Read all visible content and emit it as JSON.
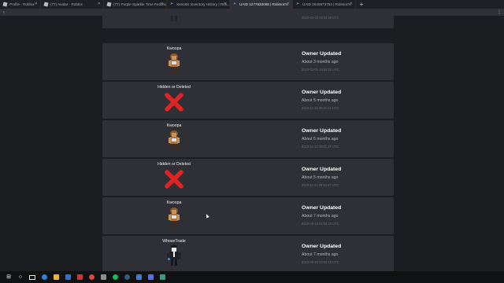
{
  "browser": {
    "tabs": [
      {
        "label": "Profile - Roblox",
        "favicon": "roblox-icon",
        "active": false
      },
      {
        "label": "(77) Avatar - Roblox",
        "favicon": "roblox-icon",
        "active": false
      },
      {
        "label": "(77) Purple Sparkle Time Fedora -",
        "favicon": "roblox-icon",
        "active": false
      },
      {
        "label": "Xenosis Inventory History | Roli...",
        "favicon": "rolimons-icon",
        "active": false
      },
      {
        "label": "UAID 1277632088 | Rolimon's",
        "favicon": "rolimons-icon",
        "active": true
      },
      {
        "label": "UAID 2640573754 | Rolimon's",
        "favicon": "rolimons-icon",
        "active": false
      }
    ],
    "new_tab_label": "+",
    "colors": {
      "accent": "#3a8fe0",
      "active_tab": "#2f3136"
    }
  },
  "history": [
    {
      "user": "",
      "event": "",
      "ago": "About 2 months ago",
      "timestamp": "2020-03-18 09:03:48 UTC",
      "thumb": "avatar-dark"
    },
    {
      "user": "Kwoopa",
      "event": "Owner Updated",
      "ago": "About 3 months ago",
      "timestamp": "2020-01-05 18:53:24 UTC",
      "thumb": "avatar-brown"
    },
    {
      "user": "Hidden or Deleted",
      "event": "Owner Updated",
      "ago": "About 5 months ago",
      "timestamp": "2019-11-18 09:01:31 UTC",
      "thumb": "red-x"
    },
    {
      "user": "Kwoopa",
      "event": "Owner Updated",
      "ago": "About 5 months ago",
      "timestamp": "2019-11-18 09:01:29 UTC",
      "thumb": "avatar-brown"
    },
    {
      "user": "Hidden or Deleted",
      "event": "Owner Updated",
      "ago": "About 5 months ago",
      "timestamp": "2019-11-12 08:51:37 UTC",
      "thumb": "red-x"
    },
    {
      "user": "Kwoopa",
      "event": "Owner Updated",
      "ago": "About 7 months ago",
      "timestamp": "2019-09-16 02:04:24 UTC",
      "thumb": "avatar-brown"
    },
    {
      "user": "WhoseTrade",
      "event": "Owner Updated",
      "ago": "About 7 months ago",
      "timestamp": "2019-09-16 02:04:19 UTC",
      "thumb": "avatar-suit"
    }
  ],
  "colors": {
    "card": "#2e3035",
    "page": "#1b1d21",
    "delete_x": "#e02424"
  }
}
